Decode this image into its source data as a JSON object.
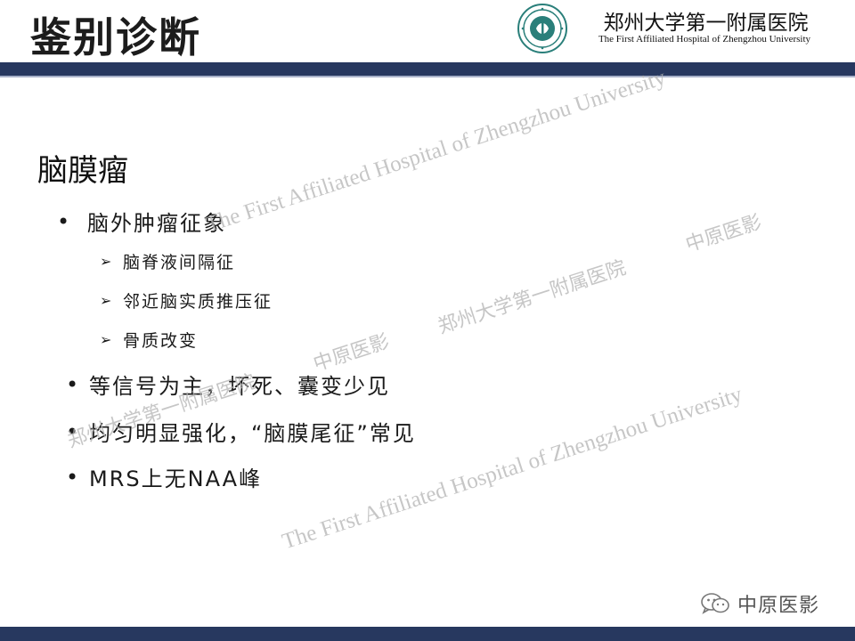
{
  "header": {
    "title": "鉴别诊断",
    "hospital_name_cn": "郑州大学第一附属医院",
    "hospital_name_en": "The First Affiliated Hospital of Zhengzhou University",
    "logo_icon": "hospital-emblem-icon",
    "bar_color": "#27385f"
  },
  "content": {
    "section_title": "脑膜瘤",
    "items": [
      {
        "level": 1,
        "text": "脑外肿瘤征象"
      },
      {
        "level": 2,
        "text": "脑脊液间隔征"
      },
      {
        "level": 2,
        "text": "邻近脑实质推压征"
      },
      {
        "level": 2,
        "text": "骨质改变"
      },
      {
        "level": 1,
        "text": "等信号为主，坏死、囊变少见"
      },
      {
        "level": 1,
        "text": "均匀明显强化，“脑膜尾征”常见"
      },
      {
        "level": 1,
        "text": "MRS上无NAA峰"
      }
    ],
    "bullet_symbol": "•",
    "sub_bullet_symbol": "➢"
  },
  "watermarks": {
    "hospital_en": "The First Affiliated Hospital of Zhengzhou University",
    "hospital_cn": "郑州大学第一附属医院",
    "zhongyuan": "中原医影"
  },
  "footer": {
    "wechat_icon": "wechat-icon",
    "account_name": "中原医影"
  }
}
